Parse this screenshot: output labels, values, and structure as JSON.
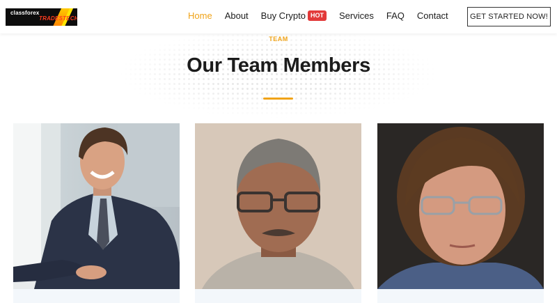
{
  "logo": {
    "line1": "classforex",
    "line2": "TRADESTECH"
  },
  "nav": {
    "items": [
      {
        "label": "Home",
        "active": true
      },
      {
        "label": "About",
        "active": false
      },
      {
        "label": "Buy Crypto",
        "active": false,
        "badge": "HOT"
      },
      {
        "label": "Services",
        "active": false
      },
      {
        "label": "FAQ",
        "active": false
      },
      {
        "label": "Contact",
        "active": false
      }
    ],
    "cta": "GET STARTED NOW!"
  },
  "section": {
    "eyebrow": "TEAM",
    "title": "Our Team Members"
  },
  "colors": {
    "accent": "#f0a318",
    "badge": "#e23a3a",
    "card_info_bg": "#f3f7fb"
  },
  "team": [
    {
      "photo": "team-member-photo-young-man-suit"
    },
    {
      "photo": "team-member-photo-older-man-glasses"
    },
    {
      "photo": "team-member-photo-woman-curly-hair"
    }
  ]
}
